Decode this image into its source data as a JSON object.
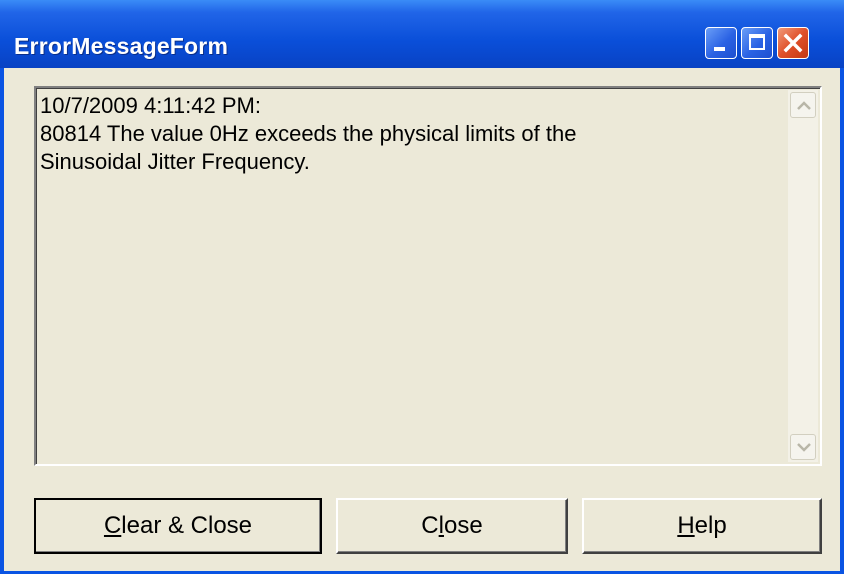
{
  "window": {
    "title": "ErrorMessageForm",
    "controls": {
      "minimize_icon": "minimize-icon",
      "maximize_icon": "maximize-icon",
      "close_icon": "close-icon"
    }
  },
  "message_box": {
    "lines": [
      "10/7/2009 4:11:42 PM:",
      "80814 The value 0Hz exceeds the physical limits of the",
      "Sinusoidal Jitter Frequency."
    ]
  },
  "buttons": {
    "clear_close": {
      "label": "Clear & Close",
      "mnemonic": "C",
      "rest": "lear & Close"
    },
    "close": {
      "label": "Close",
      "pre": "C",
      "mnemonic": "l",
      "rest": "ose"
    },
    "help": {
      "label": "Help",
      "mnemonic": "H",
      "rest": "elp"
    }
  },
  "colors": {
    "titlebar": "#0a4fd9",
    "face": "#ece9d8",
    "close_button": "#e0502a"
  }
}
